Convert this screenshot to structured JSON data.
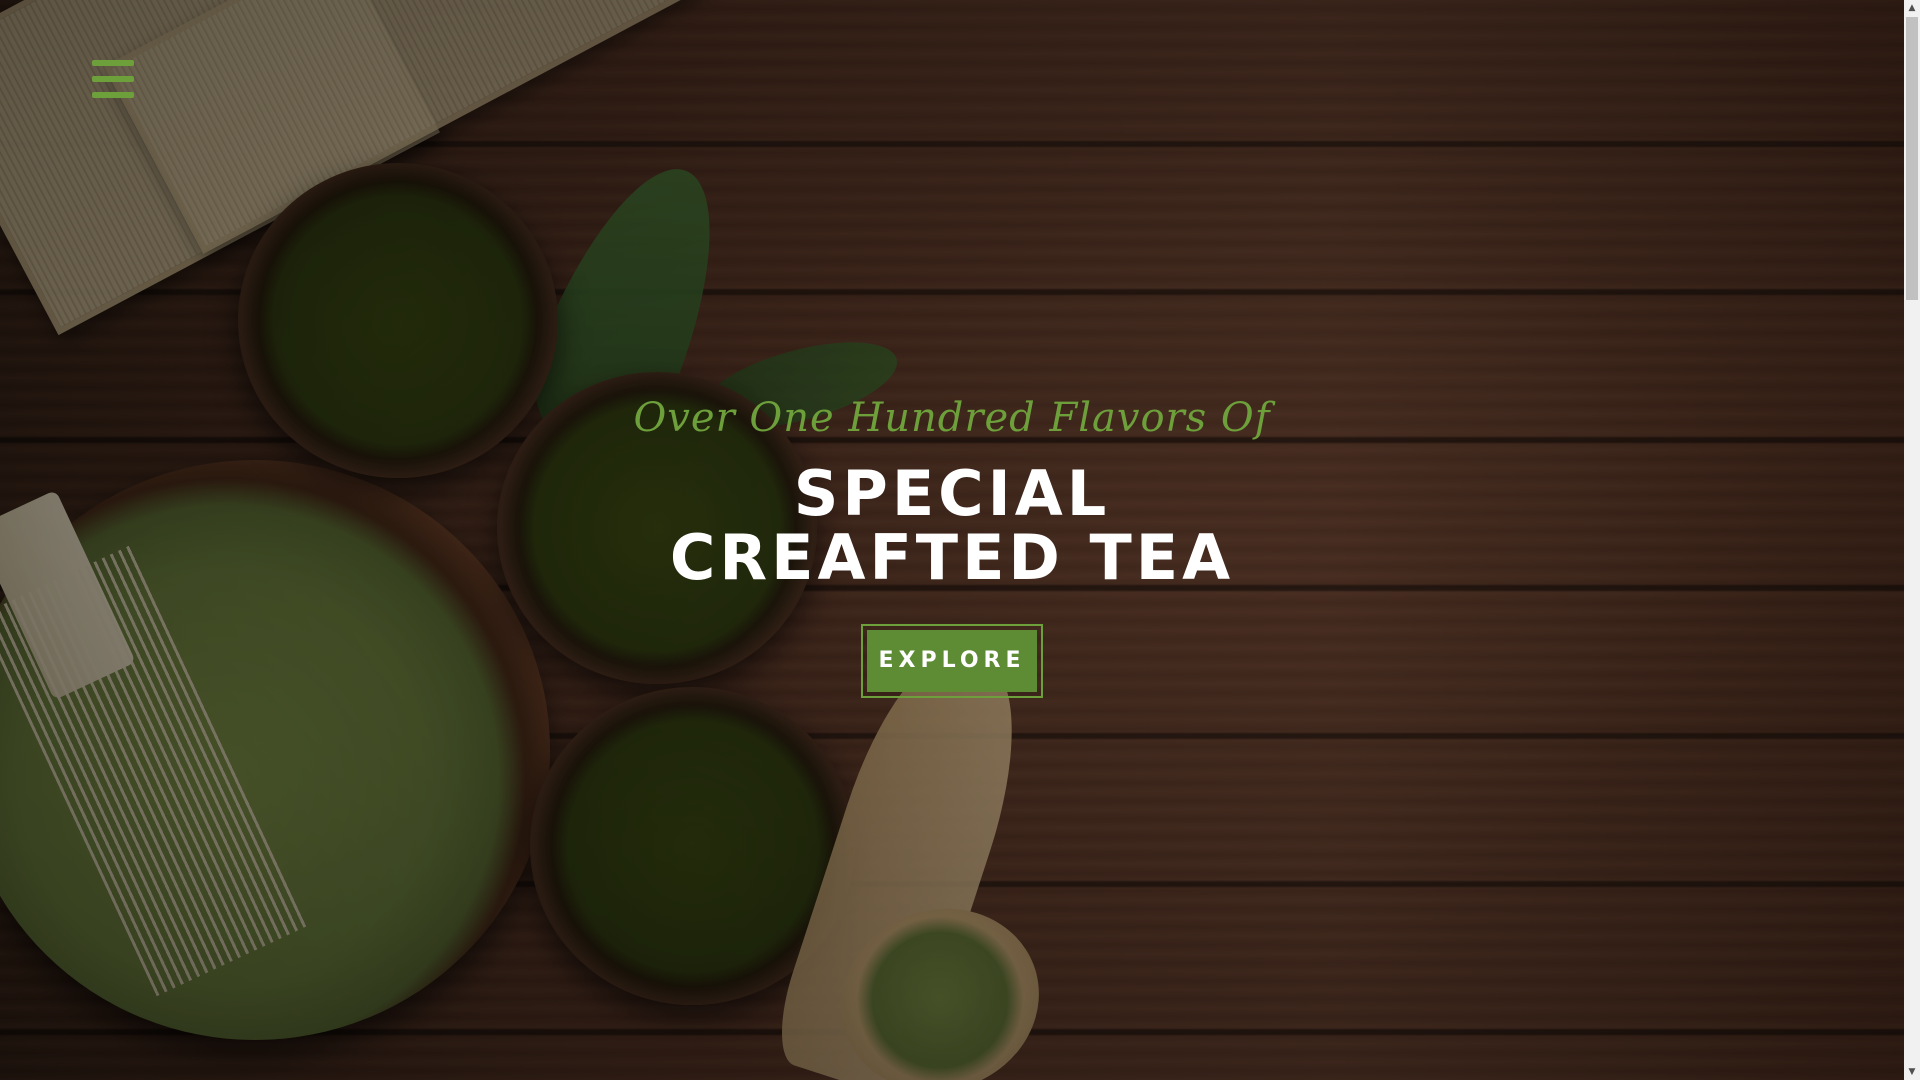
{
  "header": {
    "menu_icon": "hamburger-menu-icon",
    "accent_color": "#6d9f3b"
  },
  "hero": {
    "tagline": "Over One Hundred Flavors Of",
    "title_line_1": "SPECIAL",
    "title_line_2": "CREAFTED TEA",
    "cta_label": "EXPLORE",
    "cta_color": "#5e8c34"
  },
  "scrollbar": {
    "up_icon": "scroll-up-arrow-icon",
    "down_icon": "scroll-down-arrow-icon"
  }
}
